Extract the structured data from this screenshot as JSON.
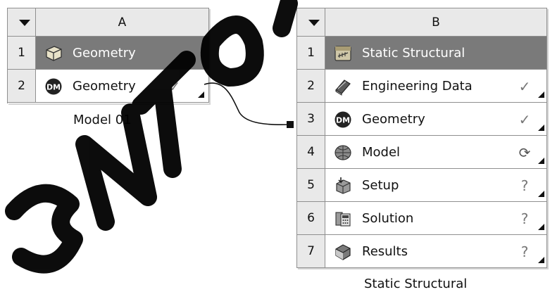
{
  "systemA": {
    "column_letter": "A",
    "rows": [
      {
        "num": "1",
        "label": "Geometry",
        "icon": "geometry-block-icon"
      },
      {
        "num": "2",
        "label": "Geometry",
        "icon": "dm-icon",
        "status": "check-icon"
      }
    ],
    "caption": "Model 01"
  },
  "systemB": {
    "column_letter": "B",
    "rows": [
      {
        "num": "1",
        "label": "Static Structural",
        "icon": "static-structural-icon"
      },
      {
        "num": "2",
        "label": "Engineering Data",
        "icon": "engineering-data-icon",
        "status": "check-icon"
      },
      {
        "num": "3",
        "label": "Geometry",
        "icon": "dm-icon",
        "status": "check-icon"
      },
      {
        "num": "4",
        "label": "Model",
        "icon": "model-icon",
        "status": "refresh-icon"
      },
      {
        "num": "5",
        "label": "Setup",
        "icon": "setup-icon",
        "status": "question-icon"
      },
      {
        "num": "6",
        "label": "Solution",
        "icon": "solution-icon",
        "status": "question-icon"
      },
      {
        "num": "7",
        "label": "Results",
        "icon": "results-icon",
        "status": "question-icon"
      }
    ],
    "caption": "Static Structural"
  },
  "colors": {
    "title_row": "#7a7a7a",
    "header": "#e9e9e9",
    "border": "#8f8f8f",
    "watermark": "#000000"
  }
}
